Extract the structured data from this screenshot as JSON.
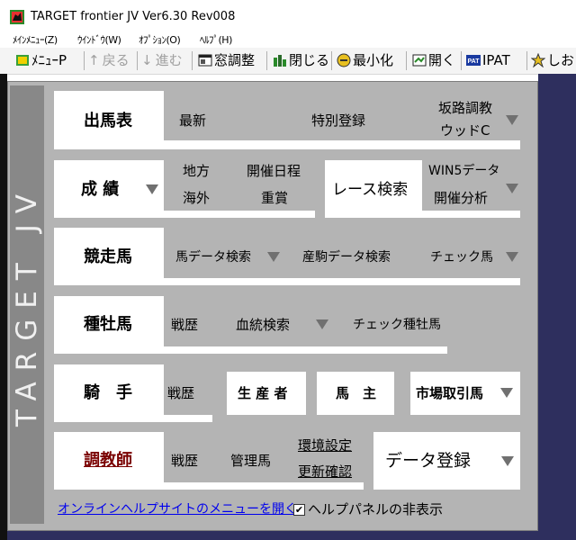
{
  "window": {
    "title": "TARGET frontier JV  Ver6.30  Rev008"
  },
  "menu": [
    "ﾒｲﾝﾒﾆｭｰ(Z)",
    "ｳｲﾝﾄﾞｳ(W)",
    "ｵﾌﾟｼｮﾝ(O)",
    "ﾍﾙﾌﾟ(H)"
  ],
  "toolbar": {
    "menu_p": "ﾒﾆｭｰP",
    "back": "戻る",
    "forward": "進む",
    "window_adjust": "窓調整",
    "close": "閉じる",
    "minimize": "最小化",
    "open": "開く",
    "ipat": "IPAT",
    "bookmark": "しおり"
  },
  "sidebar": {
    "label": "TARGET JV"
  },
  "rows": {
    "shutsuba": {
      "title": "出馬表",
      "latest": "最新",
      "special": "特別登録",
      "slope_1": "坂路調教",
      "slope_2": "ウッドC"
    },
    "seiseki": {
      "title": "成 績",
      "local": "地方",
      "overseas": "海外",
      "schedule": "開催日程",
      "graded": "重賞",
      "race_search": "レース検索",
      "win5": "WIN5データ",
      "analysis": "開催分析"
    },
    "kyousouba": {
      "title": "競走馬",
      "horse_search": "馬データ検索",
      "offspring_search": "産駒データ検索",
      "check_horse": "チェック馬"
    },
    "shuboba": {
      "title": "種牡馬",
      "record": "戦歴",
      "pedigree": "血統検索",
      "check_sire": "チェック種牡馬"
    },
    "kishu": {
      "title": "騎　手",
      "record": "戦歴",
      "breeder": "生 産 者",
      "owner": "馬　主",
      "market": "市場取引馬"
    },
    "choukyoushi": {
      "title": "調教師",
      "record": "戦歴",
      "managed": "管理馬",
      "env_settings": "環境設定",
      "update_check": "更新確認",
      "data_register": "データ登録"
    }
  },
  "footer": {
    "help_link": "オンラインヘルプサイトのメニューを開く",
    "hide_help": "ヘルプパネルの非表示",
    "hide_help_checked": true
  },
  "colors": {
    "panel": "#b4b4b4",
    "sidebar": "#888888",
    "desktop": "#2e2f5e",
    "link": "#0000ee"
  }
}
